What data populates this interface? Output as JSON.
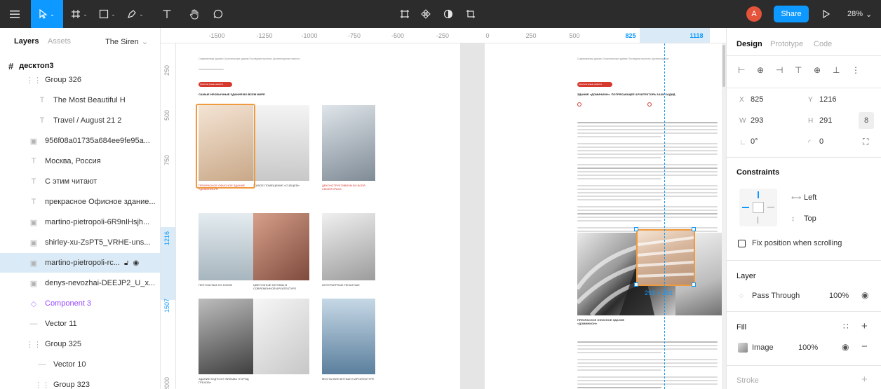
{
  "toolbar": {
    "zoom": "28%",
    "share_label": "Share",
    "avatar_initial": "A"
  },
  "left_panel": {
    "tab_layers": "Layers",
    "tab_assets": "Assets",
    "page_name": "The Siren",
    "frame_name": "десктоп3",
    "layers": [
      {
        "icon": "group-icon",
        "label": "Group 326"
      },
      {
        "icon": "text-icon",
        "label": "The Most Beautiful H"
      },
      {
        "icon": "text-icon",
        "label": "Travel / August 21 2"
      },
      {
        "icon": "image-icon",
        "label": "956f08a01735a684ee9fe95a..."
      },
      {
        "icon": "text-icon",
        "label": "Москва, Россия"
      },
      {
        "icon": "text-icon",
        "label": "С этим читают"
      },
      {
        "icon": "text-icon",
        "label": "прекрасное Офисное здание..."
      },
      {
        "icon": "image-icon",
        "label": "martino-pietropoli-6R9nIHsjh..."
      },
      {
        "icon": "image-icon",
        "label": "shirley-xu-ZsPT5_VRHE-uns..."
      },
      {
        "icon": "image-icon",
        "label": "martino-pietropoli-rc..."
      },
      {
        "icon": "image-icon",
        "label": "denys-nevozhai-DEEJP2_U_x..."
      },
      {
        "icon": "component-icon",
        "label": "Component 3"
      },
      {
        "icon": "vector-icon",
        "label": "Vector 11"
      },
      {
        "icon": "group-icon",
        "label": "Group 325"
      },
      {
        "icon": "vector-icon",
        "label": "Vector 10"
      },
      {
        "icon": "group-icon",
        "label": "Group 323"
      }
    ]
  },
  "rulers": {
    "top": [
      "-1500",
      "-1250",
      "-1000",
      "-750",
      "-500",
      "-250",
      "0",
      "250",
      "500",
      "825",
      "1118"
    ],
    "left": [
      "250",
      "500",
      "750",
      "1216",
      "1507",
      "2000"
    ]
  },
  "canvas": {
    "selection_size": "293 × 291",
    "left_frame": {
      "breadcrumbs": "Современная здания  Строительные здания  Последние проекты  Архитектурные новости",
      "tag": "Архитектурные новости",
      "heading": "САМЫЕ НЕОБЫЧНЫЕ ЗДАНИЯ ВО ВСЕМ МИРЕ",
      "captions": [
        "ПРЕКРАСНОЕ ОФИСНОЕ ЗДАНИЕ «ДОМИНИОН»",
        "ЖИЛОЕ ПОМЕЩЕНИЕ «СЧЕЩЕЙ»",
        "ДЕКОНСТРУКТИВИЗМ ВО ВСЕЙ СВОЕЙ КРАСЕ",
        "ПЕНТХАУЗЫЕ ИЗ КУБОВ",
        "ЦВЕТОЧНЫЕ МОТИВЫ В СОВРЕМЕННОЙ АРХИТЕКТУРЕ",
        "ИНТЕРЬЕРНЫЕ ПЕЧАТНЫЕ",
        "ЗДАНИЕ БУДТО ИЗ ФИЛЬМА «ГОРОД ГРЕХОВ»",
        "",
        "МОСТЫ ВЛЕЧЕТНЫЕ В АРХИТЕКТУРЕ"
      ]
    },
    "right_frame": {
      "breadcrumbs": "Современная здания  Строительные здания  Последние проекты  Архитектурные",
      "tag": "Архитектурные новости",
      "heading": "ЗДАНИЕ «ДОМИНИОН»: ПОТРЯСАЮЩЕЕ АРХИТЕКТОРА ЗАХИ ХАДИД",
      "caption": "ПРЕКРАСНОЕ ОФИСНОЕ ЗДАНИЕ «ДОМИНИОН»"
    }
  },
  "right_panel": {
    "tabs": [
      "Design",
      "Prototype",
      "Code"
    ],
    "x_label": "X",
    "x_value": "825",
    "y_label": "Y",
    "y_value": "1216",
    "w_label": "W",
    "w_value": "293",
    "h_label": "H",
    "h_value": "291",
    "rotation": "0°",
    "radius": "0",
    "constraints_title": "Constraints",
    "constraint_h": "Left",
    "constraint_v": "Top",
    "fix_position": "Fix position when scrolling",
    "layer_title": "Layer",
    "blend_mode": "Pass Through",
    "layer_opacity": "100%",
    "fill_title": "Fill",
    "fill_type": "Image",
    "fill_opacity": "100%",
    "stroke_title": "Stroke"
  }
}
